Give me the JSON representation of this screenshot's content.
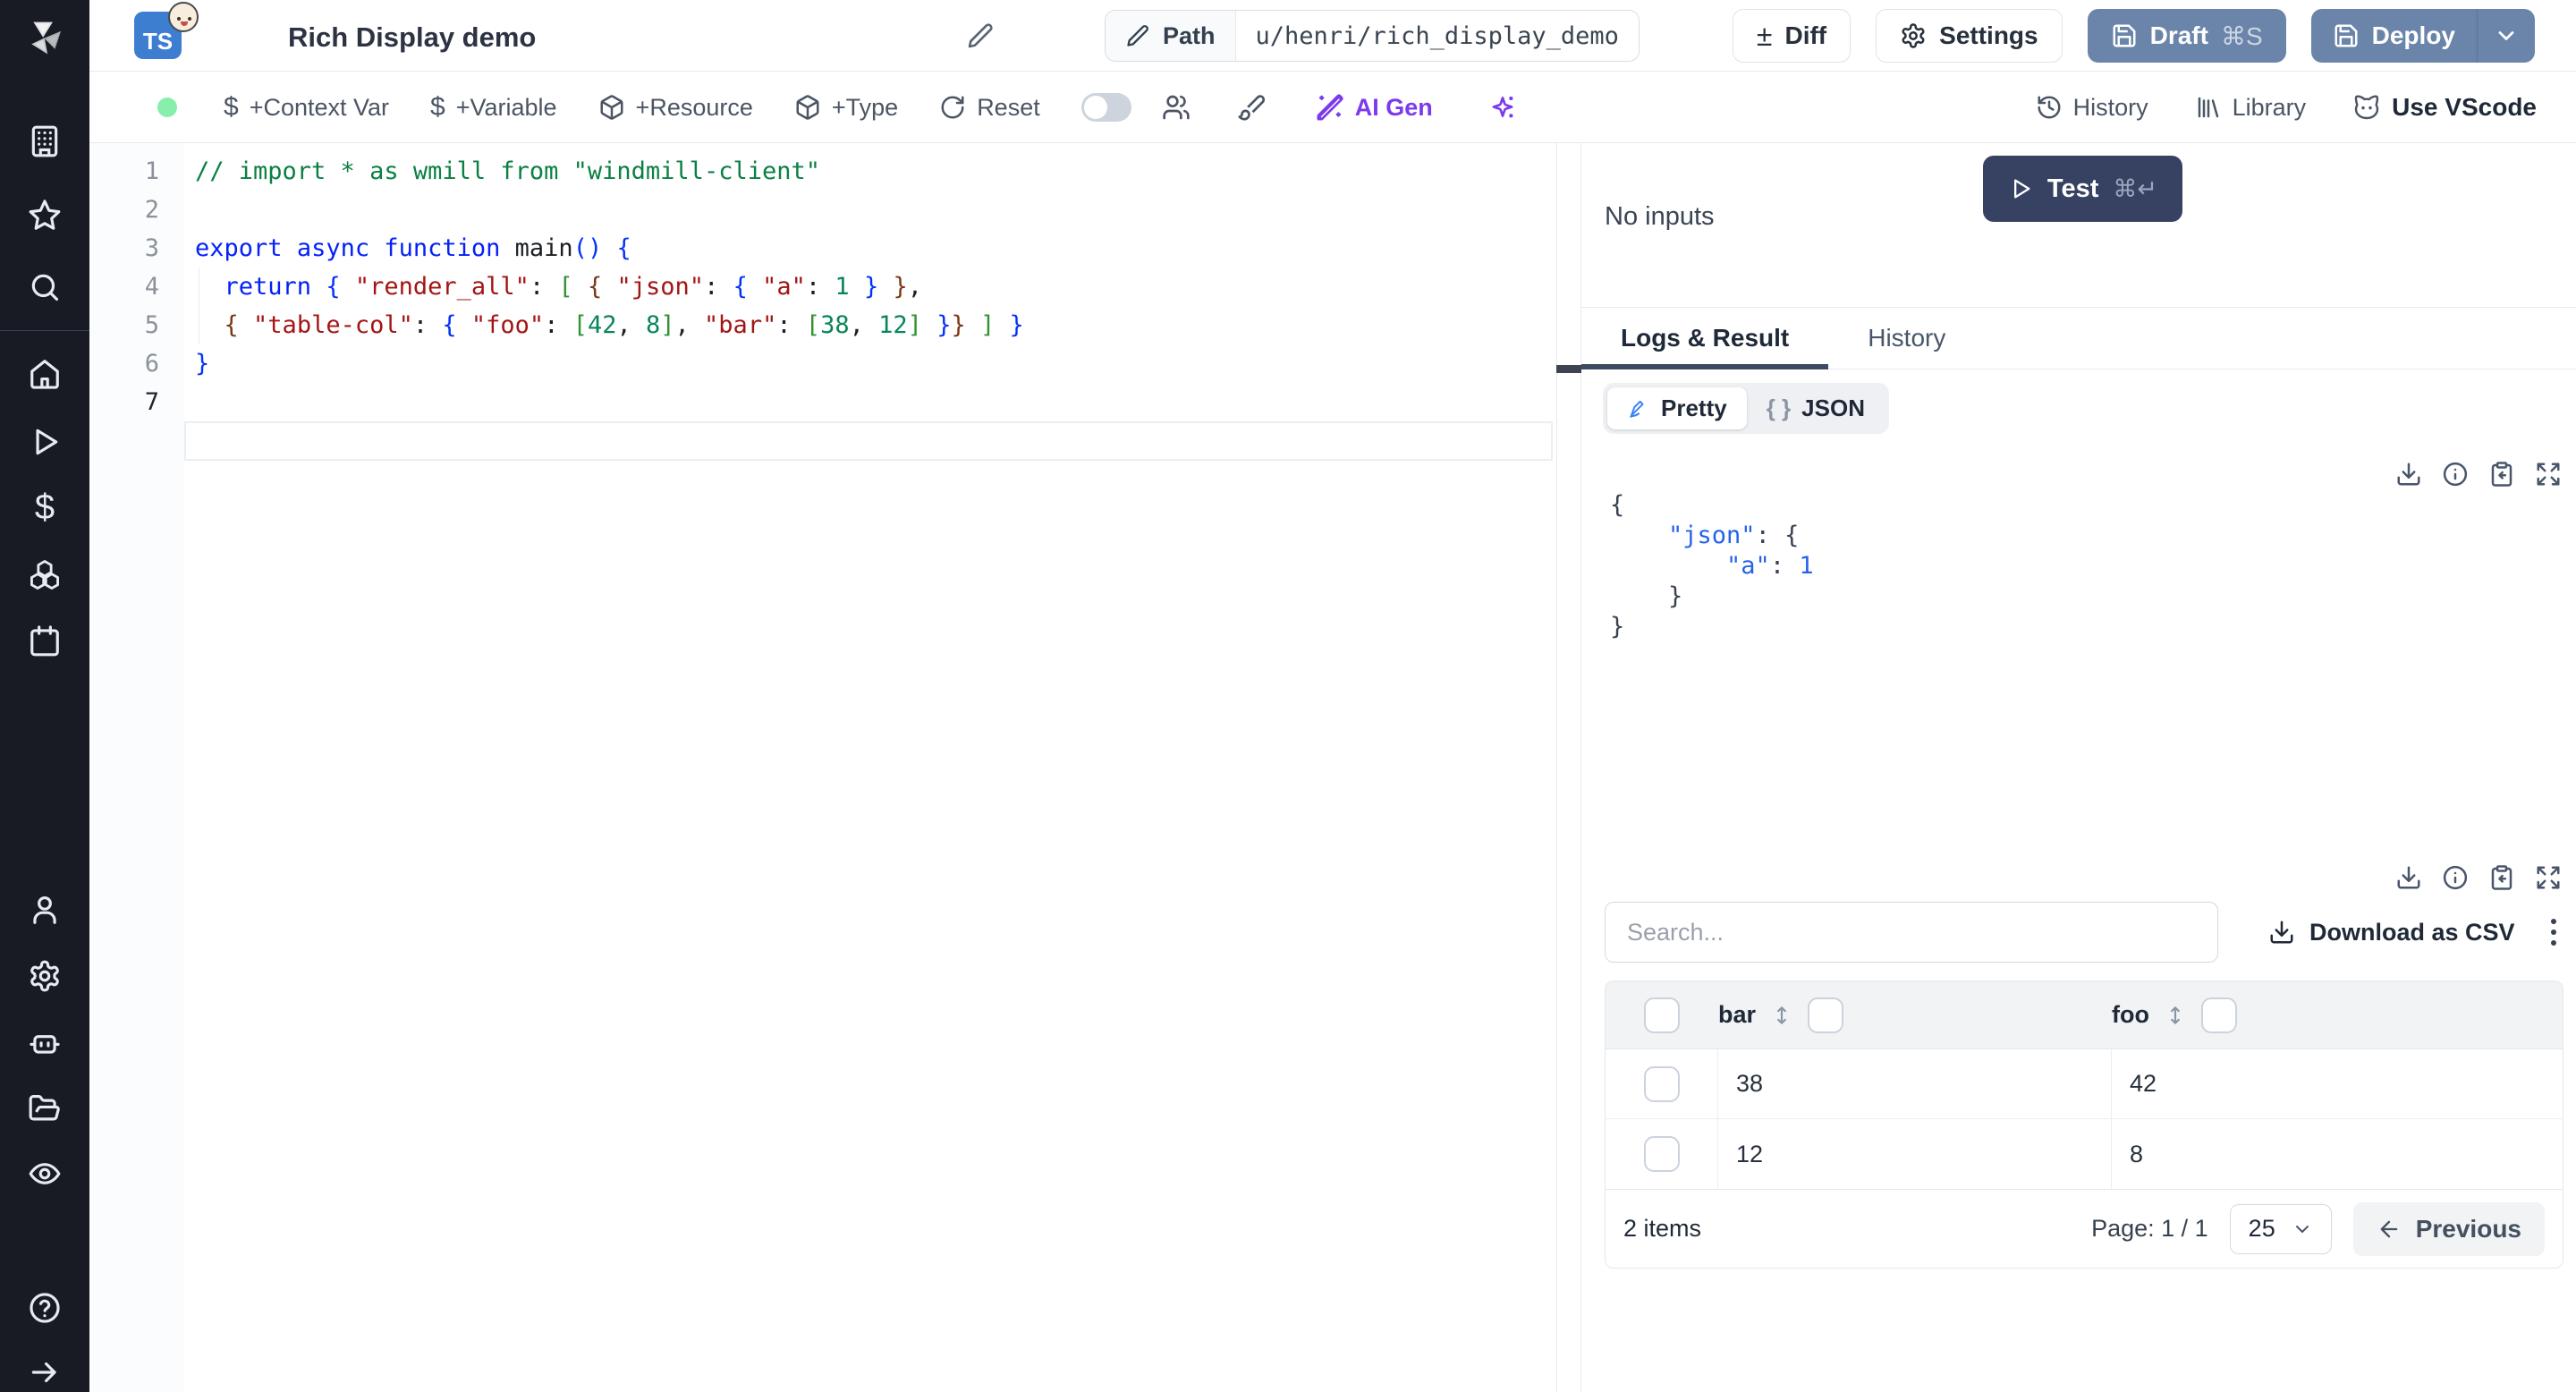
{
  "header": {
    "title": "Rich Display demo",
    "language_badge": "TS",
    "path_label": "Path",
    "path_value": "u/henri/rich_display_demo",
    "diff_label": "Diff",
    "settings_label": "Settings",
    "draft_label": "Draft",
    "draft_shortcut": "⌘S",
    "deploy_label": "Deploy"
  },
  "toolbar": {
    "status_dot_color": "#86efac",
    "context_var_label": "+Context Var",
    "variable_label": "+Variable",
    "resource_label": "+Resource",
    "type_label": "+Type",
    "reset_label": "Reset",
    "ai_gen_label": "AI Gen",
    "ai_accent_color": "#7c3aed",
    "history_label": "History",
    "library_label": "Library",
    "vscode_label": "Use VScode"
  },
  "sidebar": {
    "icons": [
      "windmill-logo",
      "building",
      "star",
      "search",
      "home",
      "play",
      "dollar",
      "boxes",
      "calendar",
      "user",
      "settings-gear",
      "robot",
      "folder-open",
      "eye",
      "help-circle",
      "arrow-right"
    ]
  },
  "editor": {
    "lines": [
      {
        "n": "1",
        "tokens": [
          [
            "cm",
            "// import * as wmill from \"windmill-client\""
          ]
        ]
      },
      {
        "n": "2",
        "tokens": []
      },
      {
        "n": "3",
        "tokens": [
          [
            "kw",
            "export"
          ],
          [
            "pl",
            " "
          ],
          [
            "kw",
            "async"
          ],
          [
            "pl",
            " "
          ],
          [
            "kw",
            "function"
          ],
          [
            "pl",
            " main"
          ],
          [
            "b1",
            "()"
          ],
          [
            "pl",
            " "
          ],
          [
            "b1",
            "{"
          ]
        ]
      },
      {
        "n": "4",
        "tokens": [
          [
            "pl",
            "  "
          ],
          [
            "kw",
            "return"
          ],
          [
            "pl",
            " "
          ],
          [
            "b1",
            "{"
          ],
          [
            "pl",
            " "
          ],
          [
            "str",
            "\"render_all\""
          ],
          [
            "pl",
            ": "
          ],
          [
            "b2",
            "["
          ],
          [
            "pl",
            " "
          ],
          [
            "b3",
            "{"
          ],
          [
            "pl",
            " "
          ],
          [
            "str",
            "\"json\""
          ],
          [
            "pl",
            ": "
          ],
          [
            "b1",
            "{"
          ],
          [
            "pl",
            " "
          ],
          [
            "str",
            "\"a\""
          ],
          [
            "pl",
            ": "
          ],
          [
            "num",
            "1"
          ],
          [
            "pl",
            " "
          ],
          [
            "b1",
            "}"
          ],
          [
            "pl",
            " "
          ],
          [
            "b3",
            "}"
          ],
          [
            "pl",
            ","
          ]
        ]
      },
      {
        "n": "5",
        "tokens": [
          [
            "pl",
            "  "
          ],
          [
            "b3",
            "{"
          ],
          [
            "pl",
            " "
          ],
          [
            "str",
            "\"table-col\""
          ],
          [
            "pl",
            ": "
          ],
          [
            "b1",
            "{"
          ],
          [
            "pl",
            " "
          ],
          [
            "str",
            "\"foo\""
          ],
          [
            "pl",
            ": "
          ],
          [
            "b2",
            "["
          ],
          [
            "num",
            "42"
          ],
          [
            "pl",
            ", "
          ],
          [
            "num",
            "8"
          ],
          [
            "b2",
            "]"
          ],
          [
            "pl",
            ", "
          ],
          [
            "str",
            "\"bar\""
          ],
          [
            "pl",
            ": "
          ],
          [
            "b2",
            "["
          ],
          [
            "num",
            "38"
          ],
          [
            "pl",
            ", "
          ],
          [
            "num",
            "12"
          ],
          [
            "b2",
            "]"
          ],
          [
            "pl",
            " "
          ],
          [
            "b1",
            "}"
          ],
          [
            "b3",
            "}"
          ],
          [
            "pl",
            " "
          ],
          [
            "b2",
            "]"
          ],
          [
            "pl",
            " "
          ],
          [
            "b1",
            "}"
          ]
        ]
      },
      {
        "n": "6",
        "tokens": [
          [
            "b1",
            "}"
          ]
        ]
      },
      {
        "n": "7",
        "tokens": []
      }
    ]
  },
  "run_panel": {
    "test_label": "Test",
    "test_shortcut": "⌘↵",
    "no_inputs_label": "No inputs",
    "tabs": [
      "Logs & Result",
      "History"
    ],
    "view_modes": [
      "Pretty",
      "JSON"
    ],
    "active_view": "Pretty",
    "json_braces_glyph": "{ }",
    "result_lines": [
      [
        [
          "p",
          "{"
        ]
      ],
      [
        [
          "p",
          "    "
        ],
        [
          "k",
          "\"json\""
        ],
        [
          "p",
          ": {"
        ]
      ],
      [
        [
          "p",
          "        "
        ],
        [
          "k",
          "\"a\""
        ],
        [
          "p",
          ": "
        ],
        [
          "n",
          "1"
        ]
      ],
      [
        [
          "p",
          "    }"
        ]
      ],
      [
        [
          "p",
          "}"
        ]
      ]
    ]
  },
  "table": {
    "search_placeholder": "Search...",
    "download_csv_label": "Download as CSV",
    "columns": [
      "bar",
      "foo"
    ],
    "rows": [
      [
        "38",
        "42"
      ],
      [
        "12",
        "8"
      ]
    ],
    "items_label": "2 items",
    "page_label": "Page: 1 / 1",
    "page_size": "25",
    "previous_label": "Previous"
  },
  "colors": {
    "accent_slate_button": "#6b84aa",
    "test_button": "#374162",
    "sidebar_bg": "#181b23",
    "active_tab_underline": "#3c4a63",
    "status_green": "#86efac"
  }
}
